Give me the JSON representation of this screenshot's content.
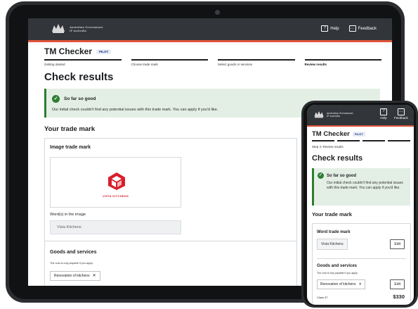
{
  "header": {
    "gov_name_line1": "Australian Government",
    "gov_name_line2": "IP Australia",
    "help_label": "Help",
    "feedback_label": "Feedback"
  },
  "app": {
    "title": "TM Checker",
    "badge": "PILOT"
  },
  "steps": [
    {
      "label": "Getting started"
    },
    {
      "label": "Choose trade mark"
    },
    {
      "label": "Select goods or services"
    },
    {
      "label": "Review results"
    }
  ],
  "page_title": "Check results",
  "alert": {
    "title": "So far so good",
    "body": "Our initial check couldn't find any potential issues with this trade mark. You can apply if you'd like."
  },
  "trade_mark": {
    "heading": "Your trade mark",
    "image_heading": "Image trade mark",
    "logo_text": "VISTA KITCHENS",
    "words_label": "Word(s) in the image",
    "words_value": "Vista Kitchens"
  },
  "goods": {
    "heading": "Goods and services",
    "note": "The cost is only payable if you apply.",
    "chip": "Renovation of kitchens"
  },
  "mobile": {
    "step_text": "Step 4: Review results",
    "alert_body": "Our initial check couldn't find any potential issues with this trade mark. You can apply if you'd like.",
    "word_heading": "Word trade mark",
    "word_value": "Vista Kitchens",
    "edit_label": "Edit",
    "class_label": "Class 37",
    "price": "$330"
  },
  "colors": {
    "header_bg": "#323539",
    "accent": "#e0553b",
    "success": "#2e7d32",
    "success_bg": "#e3efe4"
  }
}
